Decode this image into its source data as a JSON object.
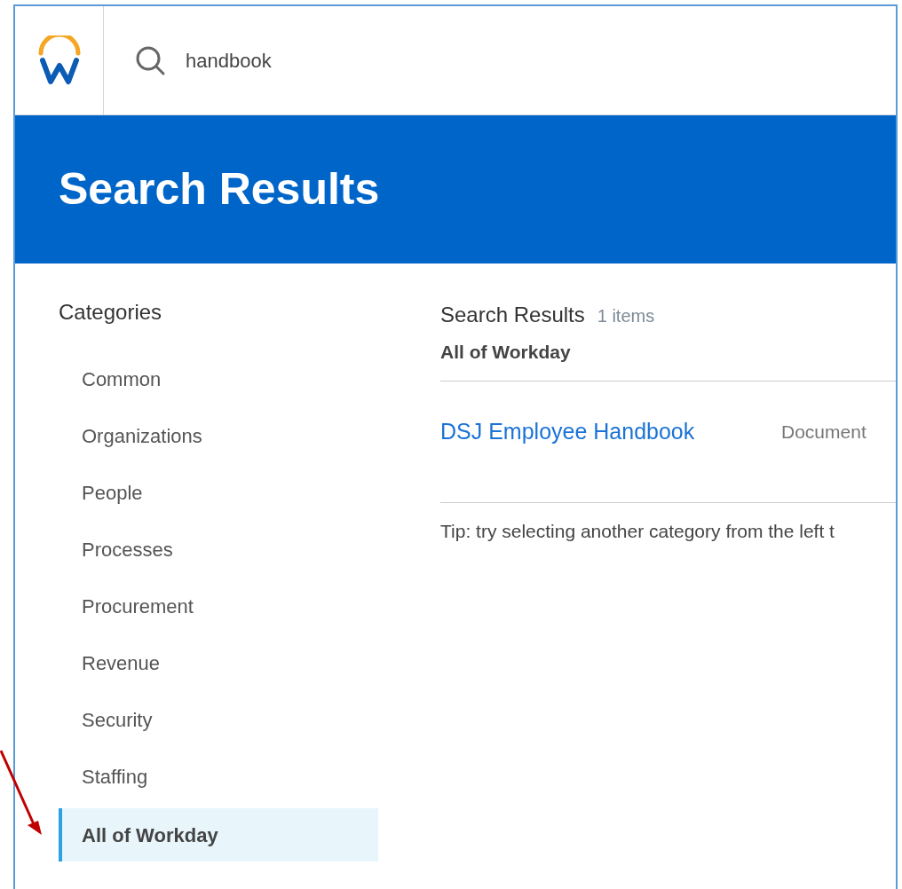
{
  "search": {
    "value": "handbook"
  },
  "header": {
    "title": "Search Results"
  },
  "categories": {
    "title": "Categories",
    "items": [
      {
        "label": "Common",
        "selected": false
      },
      {
        "label": "Organizations",
        "selected": false
      },
      {
        "label": "People",
        "selected": false
      },
      {
        "label": "Processes",
        "selected": false
      },
      {
        "label": "Procurement",
        "selected": false
      },
      {
        "label": "Revenue",
        "selected": false
      },
      {
        "label": "Security",
        "selected": false
      },
      {
        "label": "Staffing",
        "selected": false
      },
      {
        "label": "All of Workday",
        "selected": true
      }
    ]
  },
  "results": {
    "title": "Search Results",
    "count": "1 items",
    "category": "All of Workday",
    "rows": [
      {
        "title": "DSJ Employee Handbook",
        "type": "Document"
      }
    ],
    "tip": "Tip: try selecting another category from the left t"
  }
}
